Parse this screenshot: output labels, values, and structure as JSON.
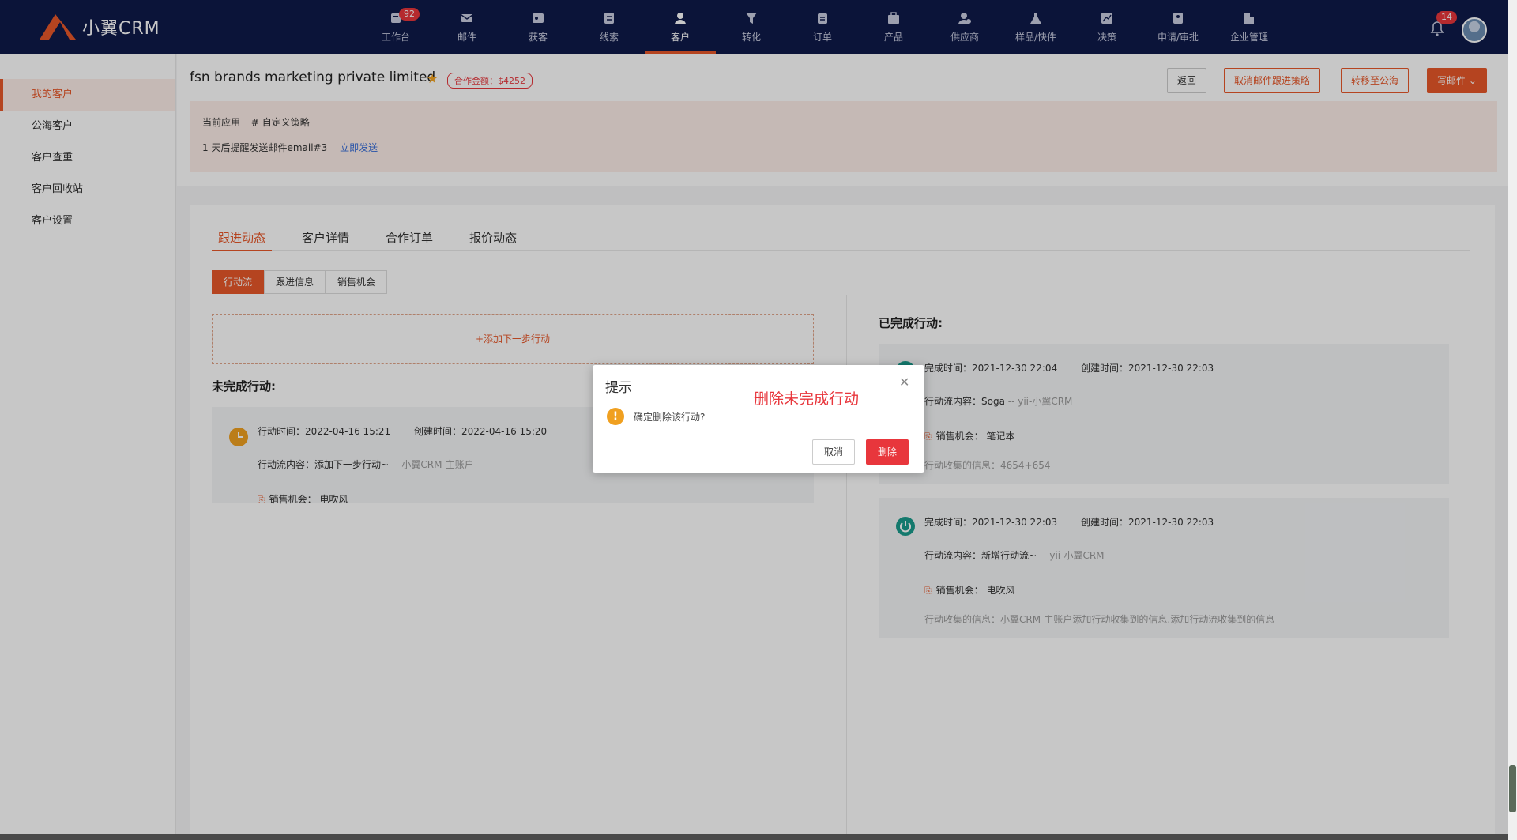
{
  "brand": {
    "name": "小翼CRM"
  },
  "nav": {
    "items": [
      {
        "label": "工作台",
        "icon": "workbench-icon",
        "badge": "92"
      },
      {
        "label": "邮件",
        "icon": "mail-icon"
      },
      {
        "label": "获客",
        "icon": "acquire-icon"
      },
      {
        "label": "线索",
        "icon": "leads-icon"
      },
      {
        "label": "客户",
        "icon": "customer-icon",
        "active": true
      },
      {
        "label": "转化",
        "icon": "funnel-icon"
      },
      {
        "label": "订单",
        "icon": "order-icon"
      },
      {
        "label": "产品",
        "icon": "product-icon"
      },
      {
        "label": "供应商",
        "icon": "supplier-icon"
      },
      {
        "label": "样品/快件",
        "icon": "sample-icon"
      },
      {
        "label": "决策",
        "icon": "decision-icon"
      },
      {
        "label": "申请/审批",
        "icon": "approval-icon"
      },
      {
        "label": "企业管理",
        "icon": "enterprise-icon"
      }
    ],
    "notification_badge": "14",
    "accent": "#e8582a",
    "background": "#0f1a4a"
  },
  "sidebar": {
    "items": [
      {
        "label": "我的客户",
        "active": true
      },
      {
        "label": "公海客户"
      },
      {
        "label": "客户查重"
      },
      {
        "label": "客户回收站"
      },
      {
        "label": "客户设置"
      }
    ]
  },
  "header": {
    "customer_name": "fsn brands marketing private limited",
    "amount": "合作金额：$4252",
    "buttons": {
      "back": "返回",
      "cancel_strategy": "取消邮件跟进策略",
      "transfer": "转移至公海",
      "write_mail": "写邮件"
    },
    "strategy": {
      "label": "当前应用",
      "name": "# 自定义策略",
      "reminder": "1 天后提醒发送邮件email#3",
      "send_now": "立即发送"
    }
  },
  "tabs": [
    "跟进动态",
    "客户详情",
    "合作订单",
    "报价动态"
  ],
  "segments": [
    "行动流",
    "跟进信息",
    "销售机会"
  ],
  "add_next": "+添加下一步行动",
  "incomplete": {
    "title": "未完成行动:",
    "card": {
      "action_time": "行动时间：2022-04-16 15:21",
      "created_time": "创建时间：2022-04-16 15:20",
      "content_label": "行动流内容：添加下一步行动~",
      "content_by": "-- 小翼CRM-主账户",
      "opportunity": "销售机会：  电吹风"
    }
  },
  "completed": {
    "title": "已完成行动:",
    "cards": [
      {
        "finish_time": "完成时间：2021-12-30 22:04",
        "created_time": "创建时间：2021-12-30 22:03",
        "content_label": "行动流内容：Soga",
        "content_by": "-- yii-小翼CRM",
        "opportunity": "销售机会：  笔记本",
        "collected": "行动收集的信息：4654+654"
      },
      {
        "finish_time": "完成时间：2021-12-30 22:03",
        "created_time": "创建时间：2021-12-30 22:03",
        "content_label": "行动流内容：新增行动流~",
        "content_by": "-- yii-小翼CRM",
        "opportunity": "销售机会：  电吹风",
        "collected": "行动收集的信息：小翼CRM-主账户添加行动收集到的信息.添加行动流收集到的信息"
      }
    ]
  },
  "dialog": {
    "title": "提示",
    "message": "确定删除该行动?",
    "annotation": "删除未完成行动",
    "cancel": "取消",
    "confirm": "删除"
  }
}
